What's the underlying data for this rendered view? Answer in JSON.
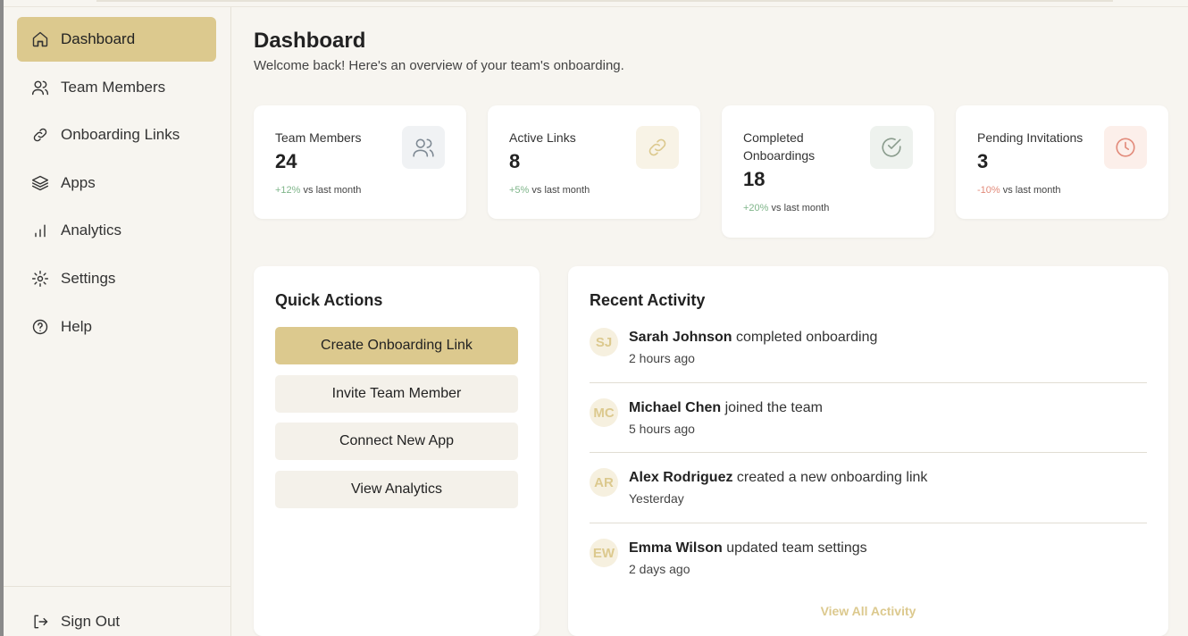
{
  "colors": {
    "accent": "#dcc98e",
    "background": "#f7f5f0",
    "card": "#ffffff",
    "positive": "#7fb58a",
    "negative": "#e28a7a"
  },
  "sidebar": {
    "items": [
      {
        "label": "Dashboard",
        "icon": "home-icon",
        "active": true
      },
      {
        "label": "Team Members",
        "icon": "users-icon"
      },
      {
        "label": "Onboarding Links",
        "icon": "link-icon"
      },
      {
        "label": "Apps",
        "icon": "layers-icon"
      },
      {
        "label": "Analytics",
        "icon": "bar-chart-icon"
      },
      {
        "label": "Settings",
        "icon": "gear-icon"
      },
      {
        "label": "Help",
        "icon": "help-circle-icon"
      }
    ],
    "sign_out": {
      "label": "Sign Out",
      "icon": "sign-out-icon"
    }
  },
  "header": {
    "title": "Dashboard",
    "subtitle": "Welcome back! Here's an overview of your team's onboarding."
  },
  "stats": [
    {
      "label": "Team Members",
      "value": "24",
      "change": "+12%",
      "change_suffix": "vs last month",
      "trend": "positive",
      "icon": "users-icon"
    },
    {
      "label": "Active Links",
      "value": "8",
      "change": "+5%",
      "change_suffix": "vs last month",
      "trend": "positive",
      "icon": "link-icon"
    },
    {
      "label": "Completed Onboardings",
      "value": "18",
      "change": "+20%",
      "change_suffix": "vs last month",
      "trend": "positive",
      "icon": "check-circle-icon"
    },
    {
      "label": "Pending Invitations",
      "value": "3",
      "change": "-10%",
      "change_suffix": "vs last month",
      "trend": "negative",
      "icon": "clock-icon"
    }
  ],
  "quick_actions": {
    "title": "Quick Actions",
    "buttons": [
      {
        "label": "Create Onboarding Link",
        "primary": true
      },
      {
        "label": "Invite Team Member"
      },
      {
        "label": "Connect New App"
      },
      {
        "label": "View Analytics"
      }
    ]
  },
  "recent_activity": {
    "title": "Recent Activity",
    "items": [
      {
        "initials": "SJ",
        "name": "Sarah Johnson",
        "action": "completed onboarding",
        "time": "2 hours ago"
      },
      {
        "initials": "MC",
        "name": "Michael Chen",
        "action": "joined the team",
        "time": "5 hours ago"
      },
      {
        "initials": "AR",
        "name": "Alex Rodriguez",
        "action": "created a new onboarding link",
        "time": "Yesterday"
      },
      {
        "initials": "EW",
        "name": "Emma Wilson",
        "action": "updated team settings",
        "time": "2 days ago"
      }
    ],
    "view_all": "View All Activity"
  }
}
